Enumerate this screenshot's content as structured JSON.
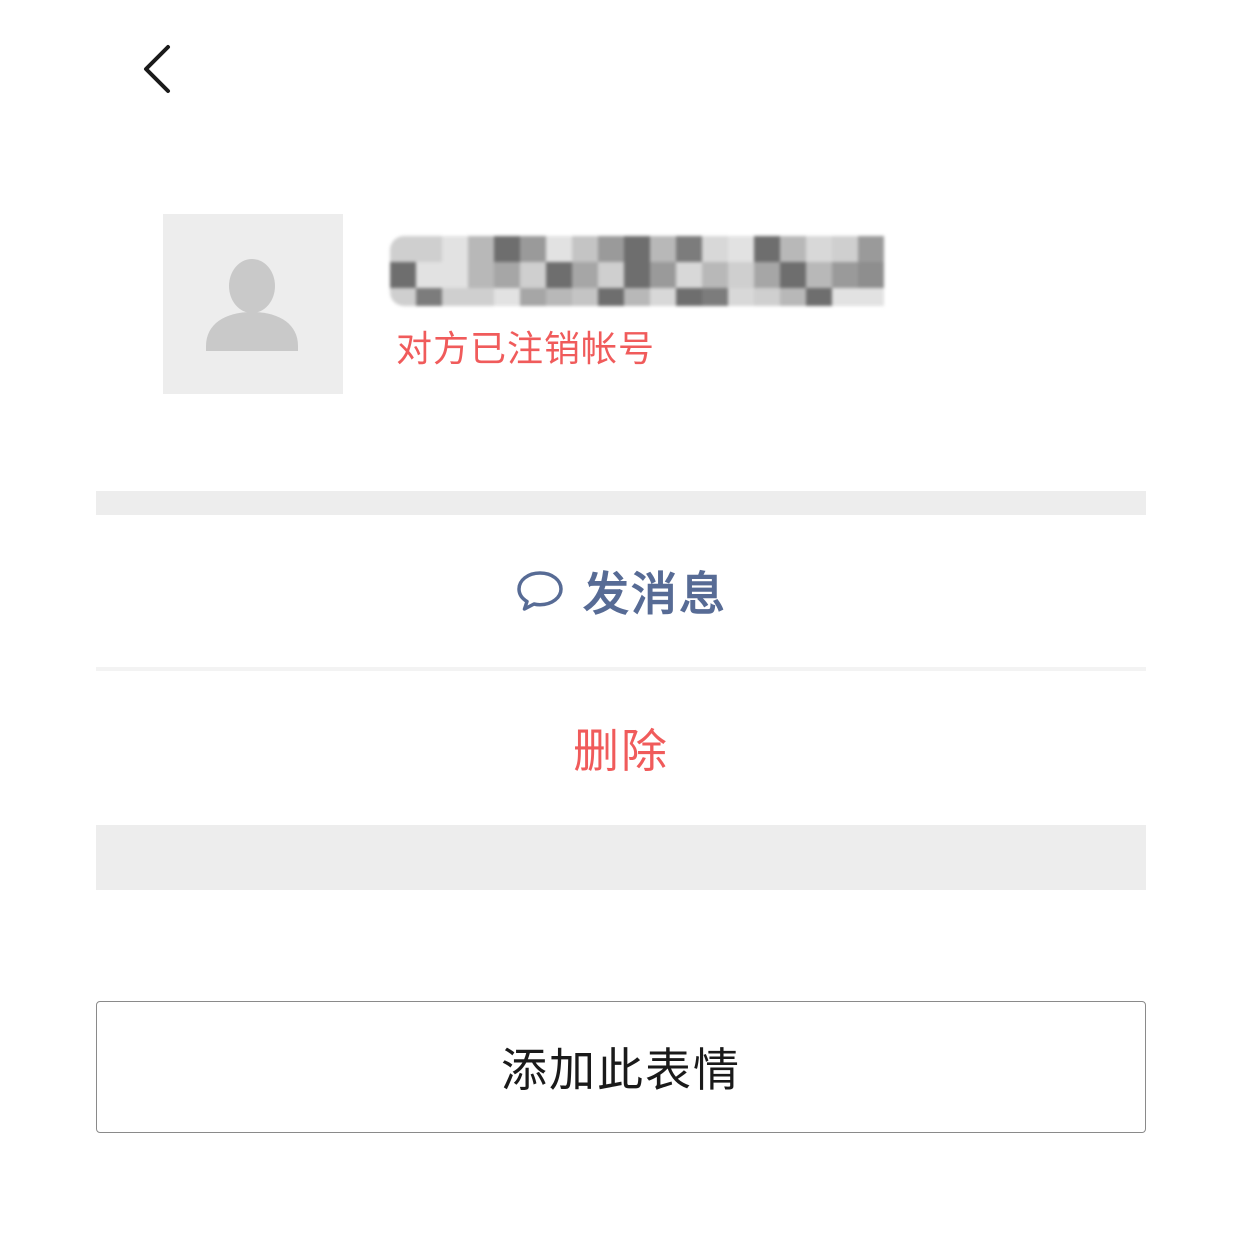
{
  "header": {
    "back_icon": "chevron-left-icon"
  },
  "profile": {
    "avatar_icon": "default-user-avatar-icon",
    "name_redacted": true,
    "status_text": "对方已注销帐号",
    "status_color": "#f05b5b"
  },
  "actions": {
    "message_icon": "chat-bubble-icon",
    "message_label": "发消息",
    "message_color": "#576b95",
    "delete_label": "删除",
    "delete_color": "#f05b5b"
  },
  "footer": {
    "add_sticker_label": "添加此表情"
  }
}
